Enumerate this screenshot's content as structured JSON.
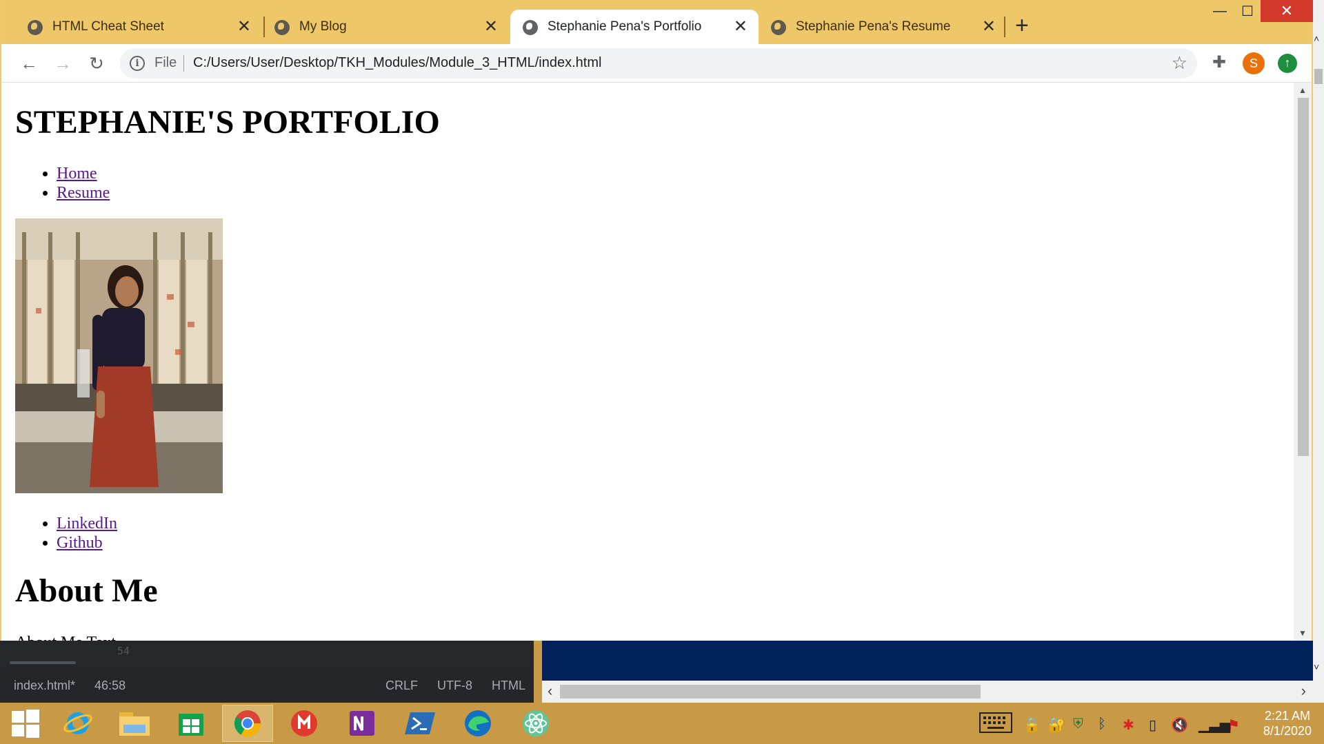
{
  "browser": {
    "tabs": [
      {
        "title": "HTML Cheat Sheet",
        "active": false
      },
      {
        "title": "My Blog",
        "active": false
      },
      {
        "title": "Stephanie Pena's Portfolio",
        "active": true
      },
      {
        "title": "Stephanie Pena's Resume",
        "active": false
      }
    ],
    "new_tab_icon": "+",
    "window_controls": {
      "minimize": "—",
      "maximize": "☐",
      "close": "✕"
    },
    "toolbar": {
      "back_icon": "←",
      "forward_icon": "→",
      "reload_icon": "↻",
      "info_icon": "i",
      "scheme": "File",
      "url": "C:/Users/User/Desktop/TKH_Modules/Module_3_HTML/index.html",
      "star_icon": "☆",
      "extensions_icon": "✚",
      "profile_initial": "S",
      "update_icon": "↑"
    }
  },
  "page": {
    "title": "STEPHANIE'S PORTFOLIO",
    "nav": [
      "Home",
      "Resume"
    ],
    "photo_alt": "Portrait photo",
    "social": [
      "LinkedIn",
      "Github"
    ],
    "about_heading": "About Me",
    "about_text": "About Me Text"
  },
  "background": {
    "editor_line": "54",
    "editor_status": {
      "file": "index.html*",
      "cursor": "46:58",
      "line_ending": "CRLF",
      "encoding": "UTF-8",
      "grammar": "HTML"
    }
  },
  "taskbar": {
    "apps": [
      "windows-start",
      "internet-explorer",
      "file-explorer",
      "store",
      "chrome",
      "app-red",
      "onenote",
      "powershell",
      "edge",
      "atom"
    ],
    "time": "2:21 AM",
    "date": "8/1/2020"
  },
  "colors": {
    "tab_bar": "#eec769",
    "link_visited": "#551a8b",
    "taskbar": "#c99a45",
    "close_red": "#d33a2b"
  }
}
